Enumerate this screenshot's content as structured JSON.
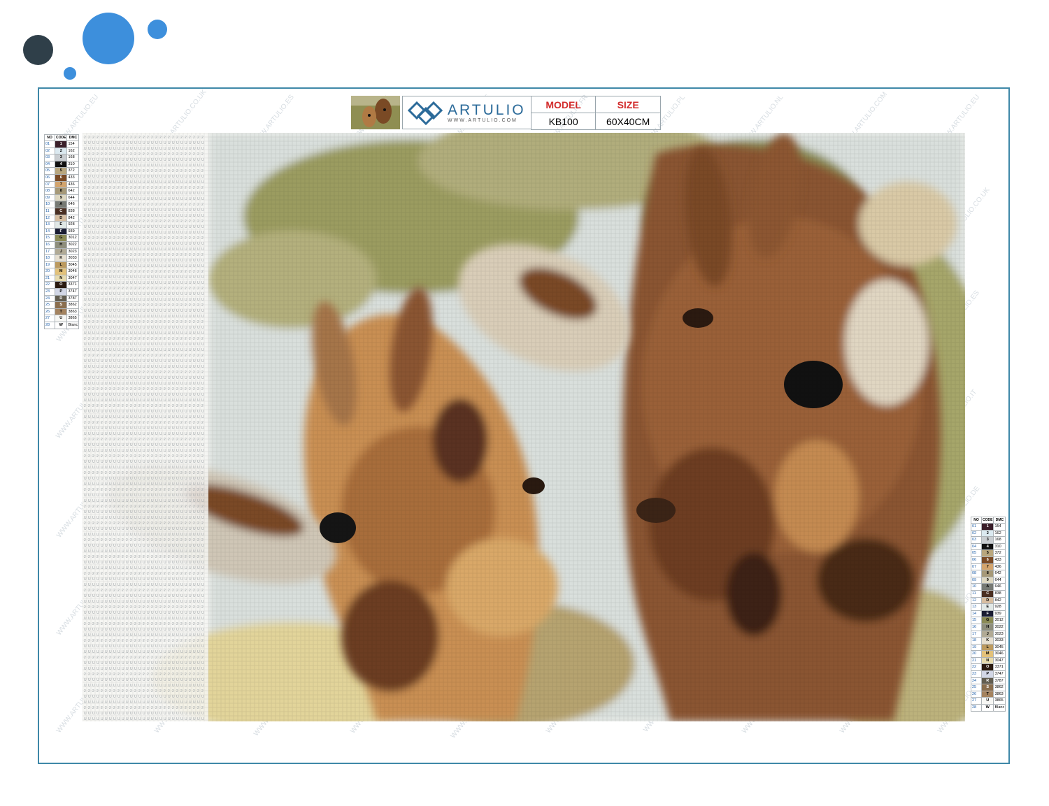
{
  "header": {
    "brand": "ARTULIO",
    "brand_url": "WWW.ARTULIO.COM",
    "model_label": "MODEL",
    "size_label": "SIZE",
    "model_value": "KB100",
    "size_value": "60X40CM"
  },
  "watermarks": [
    "WWW.ARTULIO.EU",
    "WWW.ARTULIO.CO.UK",
    "WWW.ARTULIO.ES",
    "WWW.ARTULIO.IT",
    "WWW.ARTULIO.DE",
    "WWW.ARTULIO.FR",
    "WWW.ARTULIO.PL",
    "WWW.ARTULIO.NL",
    "WWW.ARTULIO.COM"
  ],
  "colors": {
    "frame_border": "#3f88a8",
    "dot_dark": "#2f3f49",
    "dot_blue": "#3d8fdc",
    "header_red": "#d22b2b",
    "brand_blue": "#2c6b9a"
  },
  "legend": {
    "headers": [
      "NO",
      "CODE",
      "DMC"
    ],
    "rows": [
      {
        "no": "01",
        "code": "1",
        "dmc": "154",
        "color": "#3a1f2a"
      },
      {
        "no": "02",
        "code": "2",
        "dmc": "162",
        "color": "#dbe9f0"
      },
      {
        "no": "03",
        "code": "3",
        "dmc": "168",
        "color": "#c9cdd1"
      },
      {
        "no": "04",
        "code": "4",
        "dmc": "310",
        "color": "#111111"
      },
      {
        "no": "05",
        "code": "5",
        "dmc": "372",
        "color": "#b9a77e"
      },
      {
        "no": "06",
        "code": "6",
        "dmc": "433",
        "color": "#7a4a25"
      },
      {
        "no": "07",
        "code": "7",
        "dmc": "436",
        "color": "#d3a46d"
      },
      {
        "no": "08",
        "code": "8",
        "dmc": "642",
        "color": "#a69978"
      },
      {
        "no": "09",
        "code": "9",
        "dmc": "644",
        "color": "#ddd7c1"
      },
      {
        "no": "10",
        "code": "A",
        "dmc": "646",
        "color": "#777a74"
      },
      {
        "no": "11",
        "code": "C",
        "dmc": "838",
        "color": "#4a2f22"
      },
      {
        "no": "12",
        "code": "D",
        "dmc": "842",
        "color": "#d7bea1"
      },
      {
        "no": "13",
        "code": "E",
        "dmc": "928",
        "color": "#e1e8e6"
      },
      {
        "no": "14",
        "code": "F",
        "dmc": "939",
        "color": "#1a1d33"
      },
      {
        "no": "15",
        "code": "G",
        "dmc": "3012",
        "color": "#8a8a55"
      },
      {
        "no": "16",
        "code": "H",
        "dmc": "3022",
        "color": "#8e8e7c"
      },
      {
        "no": "17",
        "code": "J",
        "dmc": "3023",
        "color": "#b1aa95"
      },
      {
        "no": "18",
        "code": "K",
        "dmc": "3033",
        "color": "#e6dfd0"
      },
      {
        "no": "19",
        "code": "L",
        "dmc": "3045",
        "color": "#bc9a5f"
      },
      {
        "no": "20",
        "code": "M",
        "dmc": "3046",
        "color": "#e3c27a"
      },
      {
        "no": "21",
        "code": "N",
        "dmc": "3047",
        "color": "#e7dbae"
      },
      {
        "no": "22",
        "code": "O",
        "dmc": "3371",
        "color": "#2a1a10"
      },
      {
        "no": "23",
        "code": "P",
        "dmc": "3747",
        "color": "#d2d7e6"
      },
      {
        "no": "24",
        "code": "R",
        "dmc": "3787",
        "color": "#625d50"
      },
      {
        "no": "25",
        "code": "S",
        "dmc": "3862",
        "color": "#8a6e4e"
      },
      {
        "no": "26",
        "code": "T",
        "dmc": "3863",
        "color": "#a4835f"
      },
      {
        "no": "27",
        "code": "U",
        "dmc": "3865",
        "color": "#f7f7f4"
      },
      {
        "no": "28",
        "code": "W",
        "dmc": "Blanc",
        "color": "#ffffff"
      }
    ]
  }
}
